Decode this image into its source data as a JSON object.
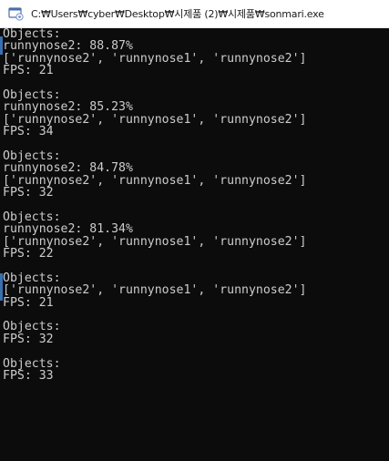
{
  "window": {
    "title": "C:₩Users₩cyber₩Desktop₩시제품 (2)₩시제품₩sonmari.exe",
    "icon": "console-app-icon"
  },
  "console": {
    "lines": [
      "Objects:",
      "runnynose2: 88.87%",
      "['runnynose2', 'runnynose1', 'runnynose2']",
      "FPS: 21",
      "",
      "Objects:",
      "runnynose2: 85.23%",
      "['runnynose2', 'runnynose1', 'runnynose2']",
      "FPS: 34",
      "",
      "Objects:",
      "runnynose2: 84.78%",
      "['runnynose2', 'runnynose1', 'runnynose2']",
      "FPS: 32",
      "",
      "Objects:",
      "runnynose2: 81.34%",
      "['runnynose2', 'runnynose1', 'runnynose2']",
      "FPS: 22",
      "",
      "Objects:",
      "['runnynose2', 'runnynose1', 'runnynose2']",
      "FPS: 21",
      "",
      "Objects:",
      "FPS: 32",
      "",
      "Objects:",
      "FPS: 33"
    ]
  },
  "colors": {
    "console_bg": "#0c0c0c",
    "console_fg": "#cccccc",
    "titlebar_bg": "#ffffff",
    "left_accent": "#3a6fb0"
  }
}
